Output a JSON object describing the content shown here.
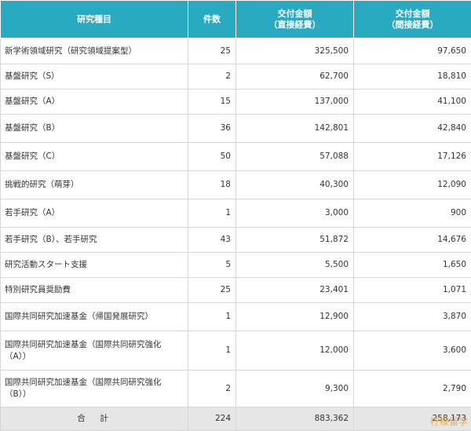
{
  "table": {
    "headers": {
      "category": "研究種目",
      "count": "件数",
      "direct_line1": "交付金額",
      "direct_line2": "（直接経費）",
      "indirect_line1": "交付金額",
      "indirect_line2": "（間接経費）"
    },
    "rows": [
      {
        "name": "新学術領域研究（研究領域提案型）",
        "count": "25",
        "direct": "325,500",
        "indirect": "97,650"
      },
      {
        "name": "基盤研究（S）",
        "count": "2",
        "direct": "62,700",
        "indirect": "18,810"
      },
      {
        "name": "基盤研究（A）",
        "count": "15",
        "direct": "137,000",
        "indirect": "41,100"
      },
      {
        "name": "基盤研究（B）",
        "count": "36",
        "direct": "142,801",
        "indirect": "42,840"
      },
      {
        "name": "基盤研究（C）",
        "count": "50",
        "direct": "57,088",
        "indirect": "17,126"
      },
      {
        "name": "挑戦的研究（萌芽）",
        "count": "18",
        "direct": "40,300",
        "indirect": "12,090"
      },
      {
        "name": "若手研究（A）",
        "count": "1",
        "direct": "3,000",
        "indirect": "900"
      },
      {
        "name": "若手研究（B）、若手研究",
        "count": "43",
        "direct": "51,872",
        "indirect": "14,676"
      },
      {
        "name": "研究活動スタート支援",
        "count": "5",
        "direct": "5,500",
        "indirect": "1,650"
      },
      {
        "name": "特別研究員奨励費",
        "count": "25",
        "direct": "23,401",
        "indirect": "1,071"
      },
      {
        "name": "国際共同研究加速基金（帰国発展研究）",
        "count": "1",
        "direct": "12,900",
        "indirect": "3,870"
      },
      {
        "name": "国際共同研究加速基金（国際共同研究強化（A））",
        "count": "1",
        "direct": "12,000",
        "indirect": "3,600"
      },
      {
        "name": "国際共同研究加速基金（国際共同研究強化（B））",
        "count": "2",
        "direct": "9,300",
        "indirect": "2,790"
      }
    ],
    "total": {
      "label": "合　計",
      "count": "224",
      "direct": "883,362",
      "indirect": "258,173"
    }
  },
  "watermark": "柠檬留学"
}
